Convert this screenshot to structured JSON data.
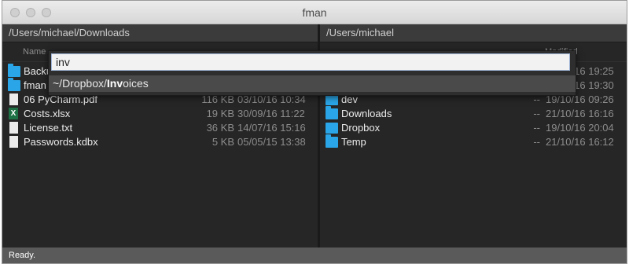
{
  "window": {
    "title": "fman"
  },
  "left_pane": {
    "path": "/Users/michael/Downloads",
    "column_name_label": "Name",
    "rows": [
      {
        "name": "Backups",
        "type": "folder",
        "size": "",
        "date": ""
      },
      {
        "name": "fman",
        "type": "folder",
        "size": "",
        "date": ""
      },
      {
        "name": "06 PyCharm.pdf",
        "type": "file",
        "size": "116 KB",
        "date": "03/10/16 10:34"
      },
      {
        "name": "Costs.xlsx",
        "type": "excel",
        "size": "19 KB",
        "date": "30/09/16 11:22"
      },
      {
        "name": "License.txt",
        "type": "file",
        "size": "36 KB",
        "date": "14/07/16 15:16"
      },
      {
        "name": "Passwords.kdbx",
        "type": "file",
        "size": "5 KB",
        "date": "05/05/15 13:38"
      }
    ]
  },
  "right_pane": {
    "path": "/Users/michael",
    "column_modified_label": "Modified",
    "rows": [
      {
        "name": "",
        "type": "folder",
        "size": "--",
        "date": "19/10/16 19:25"
      },
      {
        "name": "",
        "type": "folder",
        "size": "--",
        "date": "20/10/16 19:30"
      },
      {
        "name": "dev",
        "type": "folder",
        "size": "--",
        "date": "19/10/16 09:26"
      },
      {
        "name": "Downloads",
        "type": "folder",
        "size": "--",
        "date": "21/10/16 16:16"
      },
      {
        "name": "Dropbox",
        "type": "dropbox",
        "size": "--",
        "date": "19/10/16 20:04"
      },
      {
        "name": "Temp",
        "type": "folder",
        "size": "--",
        "date": "21/10/16 16:12"
      }
    ]
  },
  "quick_navigation": {
    "input_value": "inv",
    "suggestion_prefix": "~/Dropbox/",
    "suggestion_match": "Inv",
    "suggestion_suffix": "oices"
  },
  "status": {
    "text": "Ready."
  },
  "colors": {
    "folder": "#2aa6e8",
    "background": "#262626",
    "excel": "#1e7145"
  }
}
